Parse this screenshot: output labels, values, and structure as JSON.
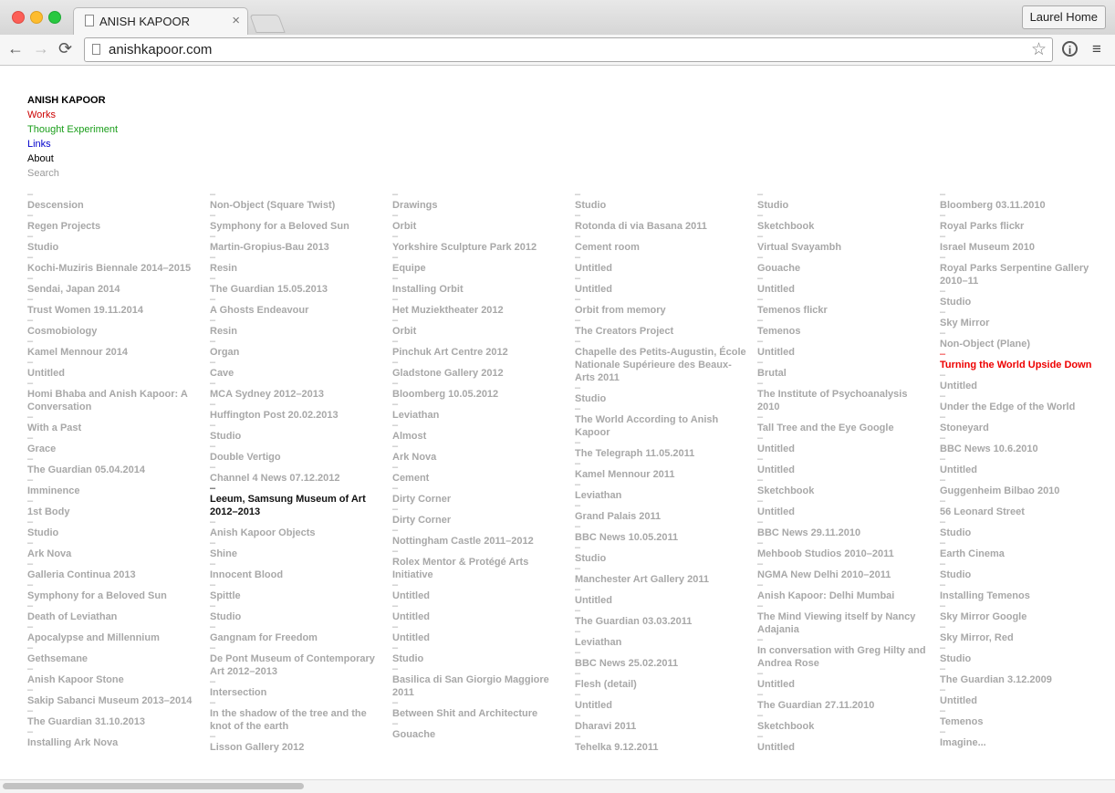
{
  "browser": {
    "tab_title": "ANISH KAPOOR",
    "tab_close": "×",
    "profile": "Laurel Home",
    "url": "anishkapoor.com",
    "back": "←",
    "forward": "→",
    "reload": "⟳",
    "star": "☆",
    "info": "i",
    "menu": "≡"
  },
  "site": {
    "title": "ANISH KAPOOR",
    "nav": {
      "works": "Works",
      "thought": "Thought Experiment",
      "links": "Links",
      "about": "About",
      "search": "Search"
    }
  },
  "colors": {
    "works": "#cc0000",
    "thought": "#1a9e1a",
    "links": "#0000cc",
    "active_red": "#ee0000",
    "muted": "#a8a8a8"
  },
  "columns": [
    [
      "Descension",
      "Regen Projects",
      "Studio",
      "Kochi-Muziris Biennale 2014–2015",
      "Sendai, Japan 2014",
      "Trust Women 19.11.2014",
      "Cosmobiology",
      "Kamel Mennour 2014",
      "Untitled",
      "Homi Bhaba and Anish Kapoor: A Conversation",
      "With a Past",
      "Grace",
      "The Guardian 05.04.2014",
      "Imminence",
      "1st Body",
      "Studio",
      "Ark Nova",
      "Galleria Continua 2013",
      "Symphony for a Beloved Sun",
      "Death of Leviathan",
      "Apocalypse and Millennium",
      "Gethsemane",
      "Anish Kapoor Stone",
      "Sakip Sabanci Museum 2013–2014",
      "The Guardian 31.10.2013",
      "Installing Ark Nova"
    ],
    [
      "Non-Object (Square Twist)",
      "Symphony for a Beloved Sun",
      "Martin-Gropius-Bau 2013",
      "Resin",
      "The Guardian 15.05.2013",
      "A Ghosts Endeavour",
      "Resin",
      "Organ",
      "Cave",
      "MCA Sydney 2012–2013",
      "Huffington Post 20.02.2013",
      "Studio",
      "Double Vertigo",
      "Channel 4 News 07.12.2012",
      "Leeum, Samsung Museum of Art 2012–2013",
      "Anish Kapoor Objects",
      "Shine",
      "Innocent Blood",
      "Spittle",
      "Studio",
      "Gangnam for Freedom",
      "De Pont Museum of Contemporary Art 2012–2013",
      "Intersection",
      "In the shadow of the tree and the knot of the earth",
      "Lisson Gallery 2012"
    ],
    [
      "Drawings",
      "Orbit",
      "Yorkshire Sculpture Park 2012",
      "Equipe",
      "Installing Orbit",
      "Het Muziektheater 2012",
      "Orbit",
      "Pinchuk Art Centre 2012",
      "Gladstone Gallery 2012",
      "Bloomberg 10.05.2012",
      "Leviathan",
      "Almost",
      "Ark Nova",
      "Cement",
      "Dirty Corner",
      "Dirty Corner",
      "Nottingham Castle 2011–2012",
      "Rolex Mentor & Protégé Arts Initiative",
      "Untitled",
      "Untitled",
      "Untitled",
      "Studio",
      "Basilica di San Giorgio Maggiore 2011",
      "Between Shit and Architecture",
      "Gouache"
    ],
    [
      "Studio",
      "Rotonda di via Basana 2011",
      "Cement room",
      "Untitled",
      "Untitled",
      "Orbit from memory",
      "The Creators Project",
      "Chapelle des Petits-Augustin, École Nationale Supérieure des Beaux-Arts 2011",
      "Studio",
      "The World According to Anish Kapoor",
      "The Telegraph 11.05.2011",
      "Kamel Mennour 2011",
      "Leviathan",
      "Grand Palais 2011",
      "BBC News 10.05.2011",
      "Studio",
      "Manchester Art Gallery 2011",
      "Untitled",
      "The Guardian 03.03.2011",
      "Leviathan",
      "BBC News 25.02.2011",
      "Flesh (detail)",
      "Untitled",
      "Dharavi 2011",
      "Tehelka 9.12.2011"
    ],
    [
      "Studio",
      "Sketchbook",
      "Virtual Svayambh",
      "Gouache",
      "Untitled",
      "Temenos flickr",
      "Temenos",
      "Untitled",
      "Brutal",
      "The Institute of Psychoanalysis 2010",
      "Tall Tree and the Eye Google",
      "Untitled",
      "Untitled",
      "Sketchbook",
      "Untitled",
      "BBC News 29.11.2010",
      "Mehboob Studios 2010–2011",
      "NGMA New Delhi 2010–2011",
      "Anish Kapoor: Delhi Mumbai",
      "The Mind Viewing itself by Nancy Adajania",
      "In conversation with Greg Hilty and Andrea Rose",
      "Untitled",
      "The Guardian 27.11.2010",
      "Sketchbook",
      "Untitled"
    ],
    [
      "Bloomberg 03.11.2010",
      "Royal Parks flickr",
      "Israel Museum 2010",
      "Royal Parks Serpentine Gallery 2010–11",
      "Studio",
      "Sky Mirror",
      "Non-Object (Plane)",
      "Turning the World Upside Down",
      "Untitled",
      "Under the Edge of the World",
      "Stoneyard",
      "BBC News 10.6.2010",
      "Untitled",
      "Guggenheim Bilbao 2010",
      "56 Leonard Street",
      "Studio",
      "Earth Cinema",
      "Studio",
      "Installing Temenos",
      "Sky Mirror Google",
      "Sky Mirror, Red",
      "Studio",
      "The Guardian 3.12.2009",
      "Untitled",
      "Temenos",
      "Imagine..."
    ]
  ],
  "highlight": {
    "dark": [
      1,
      14
    ],
    "red": [
      5,
      7
    ]
  }
}
